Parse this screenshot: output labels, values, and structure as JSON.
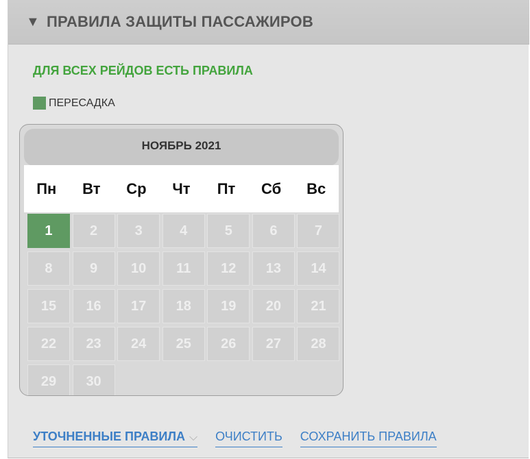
{
  "header": {
    "title": "ПРАВИЛА ЗАЩИТЫ ПАССАЖИРОВ",
    "caret": "▼"
  },
  "status_text": "ДЛЯ ВСЕХ РЕЙДОВ ЕСТЬ ПРАВИЛА",
  "legend": {
    "label": "ПЕРЕСАДКА",
    "color": "#5f9a62"
  },
  "calendar": {
    "month_label": "НОЯБРЬ 2021",
    "weekdays": [
      "Пн",
      "Вт",
      "Ср",
      "Чт",
      "Пт",
      "Сб",
      "Вс"
    ],
    "weeks": [
      [
        "1",
        "2",
        "3",
        "4",
        "5",
        "6",
        "7"
      ],
      [
        "8",
        "9",
        "10",
        "11",
        "12",
        "13",
        "14"
      ],
      [
        "15",
        "16",
        "17",
        "18",
        "19",
        "20",
        "21"
      ],
      [
        "22",
        "23",
        "24",
        "25",
        "26",
        "27",
        "28"
      ],
      [
        "29",
        "30",
        "",
        "",
        "",
        "",
        ""
      ]
    ],
    "selected_day": "1"
  },
  "footer": {
    "refined_rules": "УТОЧНЕННЫЕ ПРАВИЛА",
    "refined_chevron": "⌵",
    "clear": "ОЧИСТИТЬ",
    "save": "СОХРАНИТЬ ПРАВИЛА"
  }
}
